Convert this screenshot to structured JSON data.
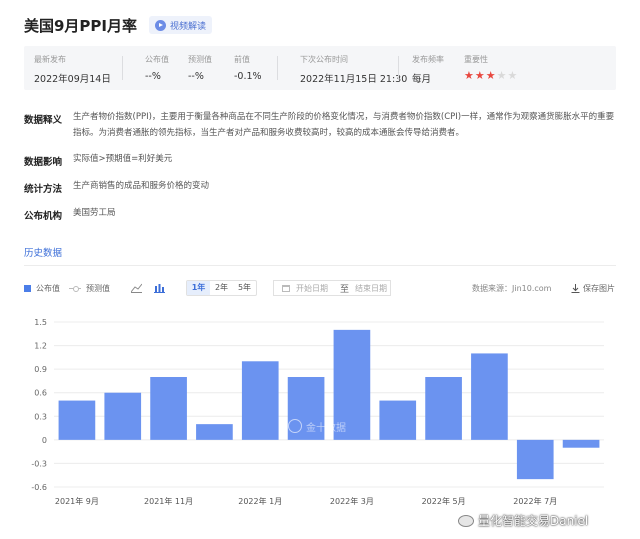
{
  "header": {
    "title": "美国9月PPI月率",
    "video_label": "视频解读"
  },
  "info": {
    "latest_release_label": "最新发布",
    "latest_release_value": "2022年09月14日",
    "actual_label": "公布值",
    "actual_value": "--%",
    "forecast_label": "预测值",
    "forecast_value": "--%",
    "previous_label": "前值",
    "previous_value": "-0.1%",
    "next_release_label": "下次公布时间",
    "next_release_value": "2022年11月15日 21:30",
    "frequency_label": "发布频率",
    "frequency_value": "每月",
    "importance_label": "重要性",
    "importance_stars": 3,
    "importance_max": 5
  },
  "details": [
    {
      "key": "数据释义",
      "text": "生产者物价指数(PPI)，主要用于衡量各种商品在不同生产阶段的价格变化情况，与消费者物价指数(CPI)一样，通常作为观察通货膨胀水平的重要指标。为消费者通胀的领先指标，当生产者对产品和服务收费较高时，较高的成本通胀会传导给消费者。"
    },
    {
      "key": "数据影响",
      "text": "实际值>预期值=利好美元"
    },
    {
      "key": "统计方法",
      "text": "生产商销售的成品和服务价格的变动"
    },
    {
      "key": "公布机构",
      "text": "美国劳工局"
    }
  ],
  "history": {
    "title": "历史数据",
    "legend_actual": "公布值",
    "legend_forecast": "预测值",
    "ranges": [
      "1年",
      "2年",
      "5年"
    ],
    "active_range": "1年",
    "start_placeholder": "开始日期",
    "end_placeholder": "结束日期",
    "range_separator": "至",
    "source": "数据来源：Jin10.com",
    "save_image": "保存图片"
  },
  "chart_data": {
    "type": "bar",
    "categories": [
      "2021年9月",
      "2021年10月",
      "2021年11月",
      "2021年12月",
      "2022年1月",
      "2022年2月",
      "2022年3月",
      "2022年4月",
      "2022年5月",
      "2022年6月",
      "2022年7月",
      "2022年8月"
    ],
    "tick_labels": [
      "2021年 9月",
      "2021年 11月",
      "2022年 1月",
      "2022年 3月",
      "2022年 5月",
      "2022年 7月"
    ],
    "series": [
      {
        "name": "公布值",
        "values": [
          0.5,
          0.6,
          0.8,
          0.2,
          1.0,
          0.8,
          1.4,
          0.5,
          0.8,
          1.1,
          -0.5,
          -0.1
        ]
      }
    ],
    "yticks": [
      "1.5",
      "1.2",
      "0.9",
      "0.6",
      "0.3",
      "0",
      "-0.3",
      "-0.6"
    ],
    "ylim": [
      -0.6,
      1.5
    ],
    "bar_color": "#6b93f0",
    "grid": true
  },
  "watermarks": {
    "chart_logo": "金十数据",
    "weibo": "量化智能交易Daniel"
  }
}
